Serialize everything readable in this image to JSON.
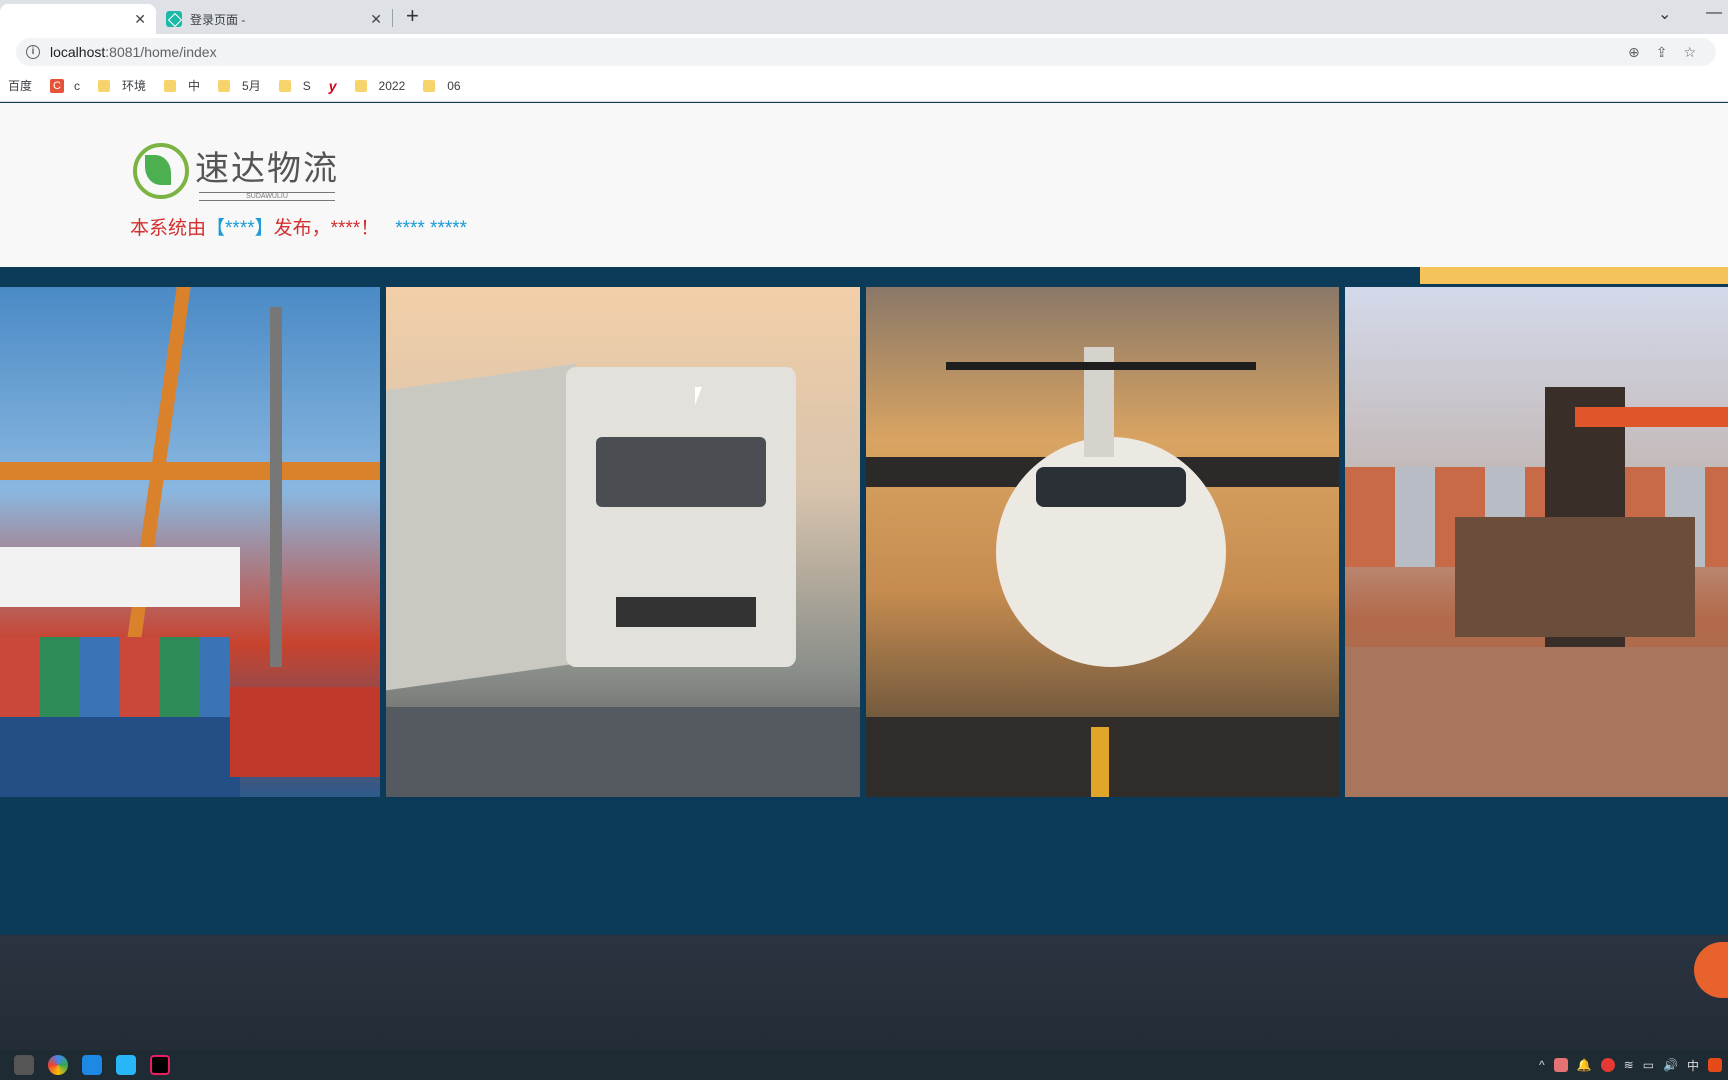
{
  "browser": {
    "tabs": [
      {
        "label": "",
        "active": true
      },
      {
        "label": "登录页面 -",
        "active": false
      }
    ],
    "new_tab": "+",
    "url_host": "localhost",
    "url_path": ":8081/home/index",
    "bookmarks": [
      {
        "label": "百度",
        "icon": "none"
      },
      {
        "label": "c",
        "icon": "c-icon"
      },
      {
        "label": "环境",
        "icon": "folder-icon"
      },
      {
        "label": "中",
        "icon": "folder-icon"
      },
      {
        "label": "5月",
        "icon": "folder-icon"
      },
      {
        "label": "S",
        "icon": "folder-icon"
      },
      {
        "label": "y",
        "icon": "y-icon"
      },
      {
        "label": "2022",
        "icon": "folder-icon"
      },
      {
        "label": "06",
        "icon": "folder-icon"
      }
    ]
  },
  "header": {
    "logo_cn": "速达物流",
    "logo_en": "SUDAWULIU",
    "notice_prefix": "本系统由",
    "notice_bracket_open": "【",
    "notice_stars": "****",
    "notice_bracket_close": "】",
    "notice_middle": "发布，****！",
    "notice_contact": "**** *****"
  },
  "banner": {
    "photos": [
      "port-crane-ship",
      "white-truck",
      "propeller-airplane",
      "forklift-containers"
    ]
  },
  "taskbar": {
    "tray_ime": "中"
  },
  "colors": {
    "notice_red": "#d32f2f",
    "notice_blue": "#1a9bd7",
    "banner_bg": "#0c3b5a"
  }
}
